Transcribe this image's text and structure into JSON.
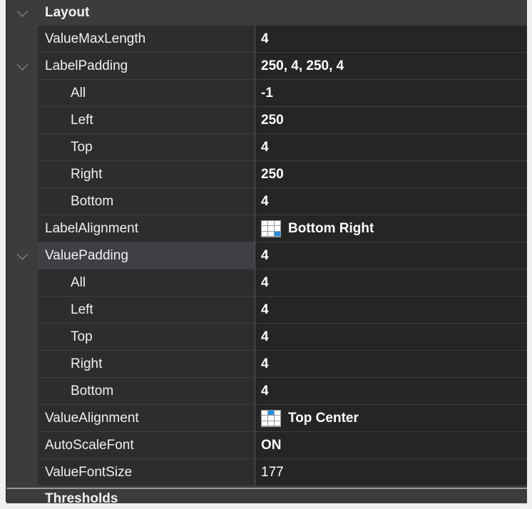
{
  "categories": {
    "layout": "Layout",
    "next": "Thresholds"
  },
  "rows": [
    {
      "name": "ValueMaxLength",
      "value": "4"
    },
    {
      "name": "LabelPadding",
      "value": "250, 4, 250, 4"
    },
    {
      "name": "All",
      "value": "-1"
    },
    {
      "name": "Left",
      "value": "250"
    },
    {
      "name": "Top",
      "value": "4"
    },
    {
      "name": "Right",
      "value": "250"
    },
    {
      "name": "Bottom",
      "value": "4"
    },
    {
      "name": "LabelAlignment",
      "value": "Bottom Right"
    },
    {
      "name": "ValuePadding",
      "value": "4"
    },
    {
      "name": "All",
      "value": "4"
    },
    {
      "name": "Left",
      "value": "4"
    },
    {
      "name": "Top",
      "value": "4"
    },
    {
      "name": "Right",
      "value": "4"
    },
    {
      "name": "Bottom",
      "value": "4"
    },
    {
      "name": "ValueAlignment",
      "value": "Top Center"
    },
    {
      "name": "AutoScaleFont",
      "value": "ON"
    },
    {
      "name": "ValueFontSize",
      "value": "177"
    }
  ],
  "colors": {
    "background": "#252526",
    "name_column": "#2d2d30",
    "category": "#3c3c3c",
    "selected": "#3f3f46",
    "accent": "#1e8ee8"
  },
  "icons": {
    "expander": "chevron-down-icon",
    "alignment": "content-alignment-grid-icon"
  }
}
